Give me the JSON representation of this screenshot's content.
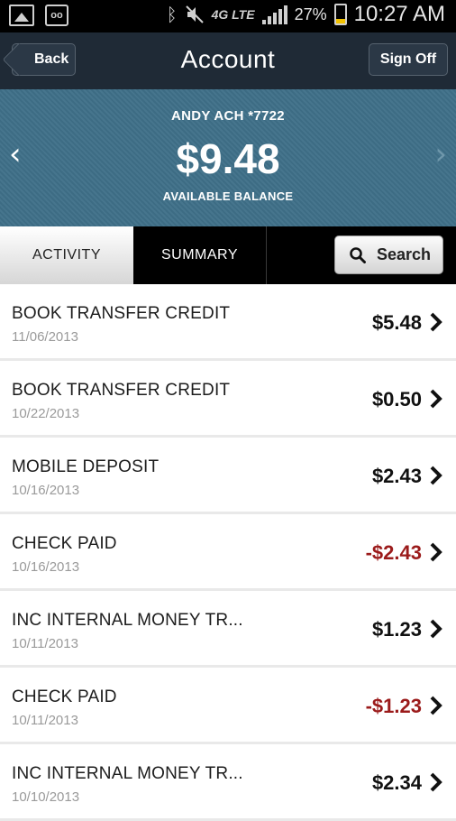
{
  "status_bar": {
    "battery_percent": "27%",
    "time": "10:27 AM",
    "network": "4G LTE",
    "icons": [
      "image-icon",
      "voicemail-icon",
      "bluetooth-icon",
      "mute-icon",
      "signal-icon",
      "battery-icon"
    ]
  },
  "nav": {
    "back_label": "Back",
    "title": "Account",
    "signoff_label": "Sign Off"
  },
  "balance": {
    "account_name": "ANDY ACH *7722",
    "amount": "$9.48",
    "label": "AVAILABLE BALANCE"
  },
  "tabs": {
    "activity": "ACTIVITY",
    "summary": "SUMMARY",
    "search": "Search",
    "selected": "ACTIVITY"
  },
  "colors": {
    "nav_bg": "#1f2a36",
    "balance_bg": "#3f7089",
    "negative_amount": "#9b1b1b"
  },
  "transactions": [
    {
      "description": "BOOK TRANSFER CREDIT",
      "date": "11/06/2013",
      "amount": "$5.48",
      "negative": false
    },
    {
      "description": "BOOK TRANSFER CREDIT",
      "date": "10/22/2013",
      "amount": "$0.50",
      "negative": false
    },
    {
      "description": "MOBILE DEPOSIT",
      "date": "10/16/2013",
      "amount": "$2.43",
      "negative": false
    },
    {
      "description": "CHECK PAID",
      "date": "10/16/2013",
      "amount": "-$2.43",
      "negative": true
    },
    {
      "description": "INC INTERNAL MONEY TR...",
      "date": "10/11/2013",
      "amount": "$1.23",
      "negative": false
    },
    {
      "description": "CHECK PAID",
      "date": "10/11/2013",
      "amount": "-$1.23",
      "negative": true
    },
    {
      "description": "INC INTERNAL MONEY TR...",
      "date": "10/10/2013",
      "amount": "$2.34",
      "negative": false
    }
  ]
}
